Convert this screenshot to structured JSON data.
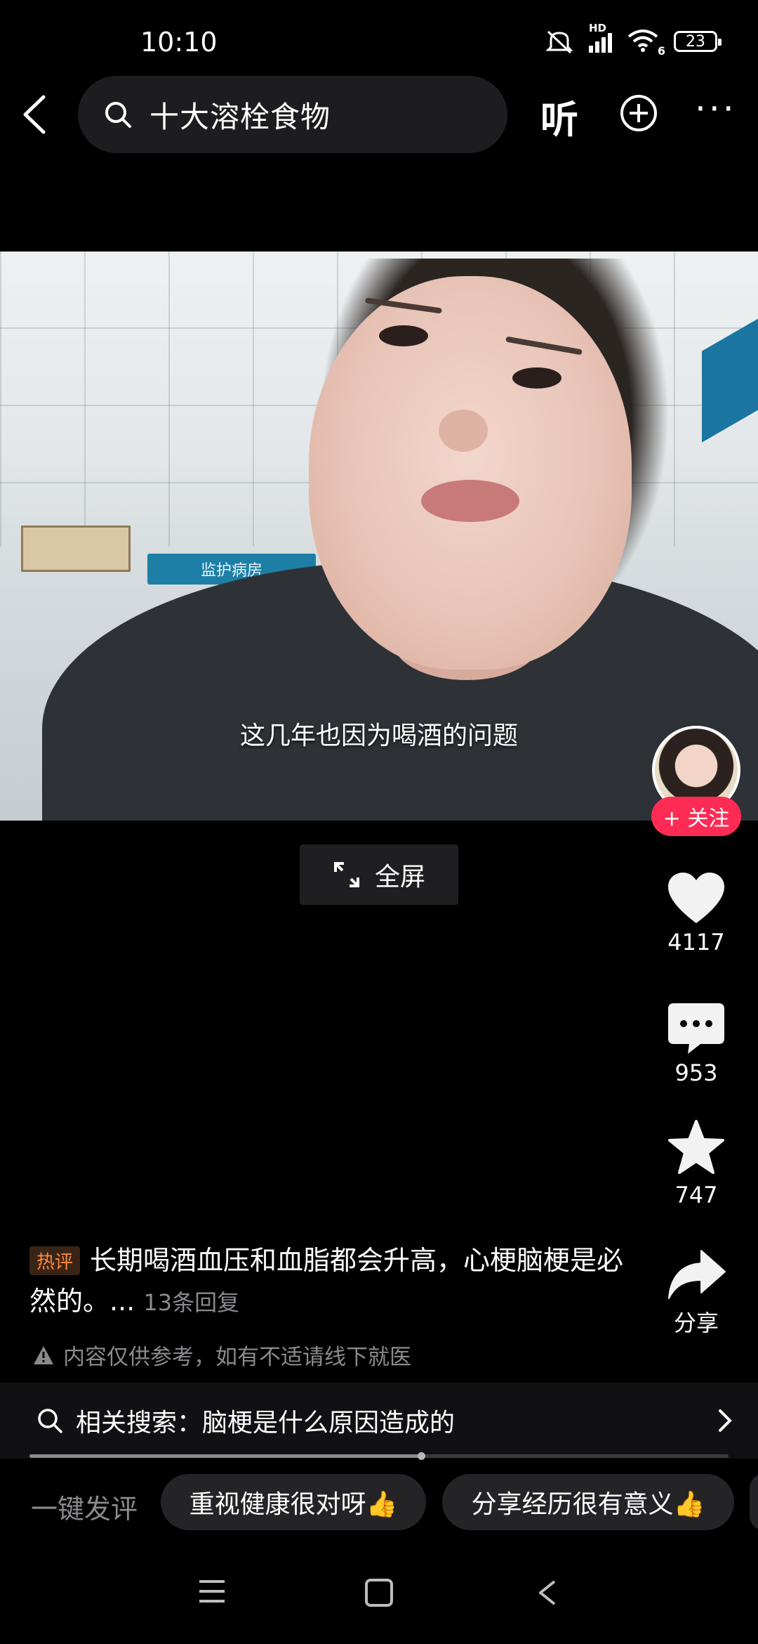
{
  "status_bar": {
    "time": "10:10",
    "network_label": "HD",
    "wifi_label": "6",
    "battery": "23"
  },
  "header": {
    "search_query": "十大溶栓食物",
    "listen_label": "听"
  },
  "video": {
    "subtitle": "这几年也因为喝酒的问题",
    "board_text": "监护病房",
    "fullscreen_label": "全屏"
  },
  "sidebar": {
    "follow_label": "+ 关注",
    "likes": "4117",
    "comments": "953",
    "favorites": "747",
    "share_label": "分享"
  },
  "hot_comment": {
    "tag": "热评",
    "text": "长期喝酒血压和血脂都会升高，心梗脑梗是必然的。...",
    "replies": "13条回复"
  },
  "disclaimer": "内容仅供参考，如有不适请线下就医",
  "related_search": {
    "text": "相关搜索：脑梗是什么原因造成的",
    "progress": 0.56
  },
  "quick_comment": {
    "label": "一键发评",
    "options": [
      "重视健康很对呀👍",
      "分享经历很有意义👍"
    ]
  },
  "colors": {
    "background": "#000000",
    "follow_button": "#fe2c55",
    "hot_tag": "#ff8a3d",
    "secondary_text": "#8a8a8e"
  }
}
